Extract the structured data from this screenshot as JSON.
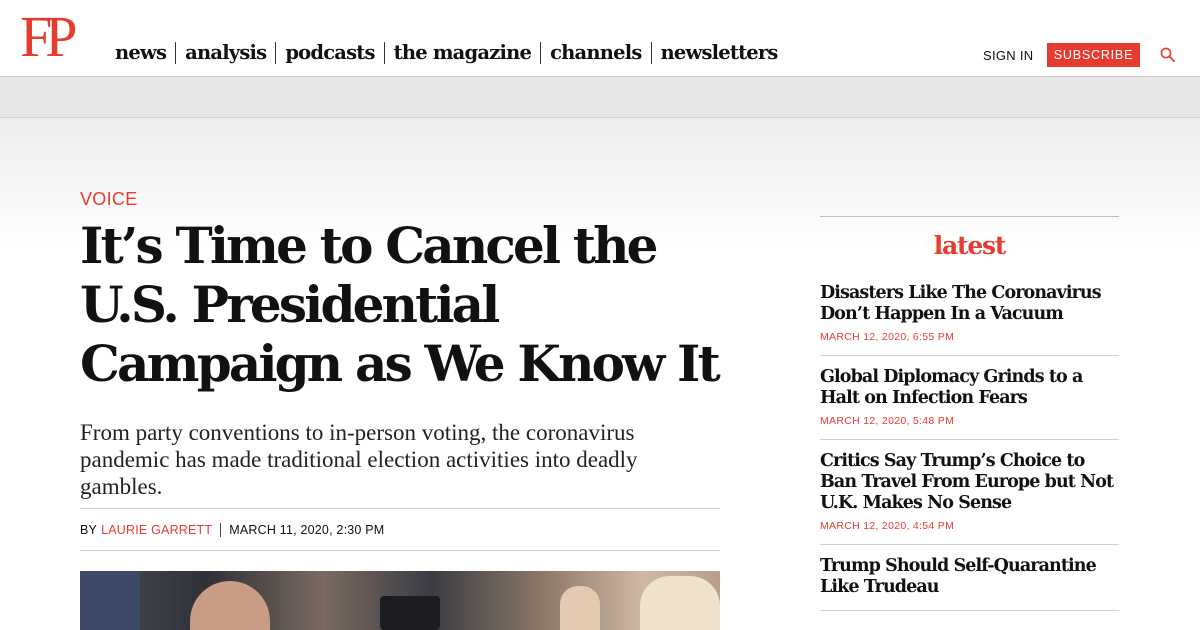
{
  "header": {
    "logo": "FP",
    "nav": [
      "news",
      "analysis",
      "podcasts",
      "the magazine",
      "channels",
      "newsletters"
    ],
    "sign_in": "SIGN IN",
    "subscribe": "SUBSCRIBE",
    "accent_color": "#e63c2f"
  },
  "article": {
    "kicker": "VOICE",
    "headline": "It’s Time to Cancel the U.S. Presidential Campaign as We Know It",
    "dek": "From party conventions to in-person voting, the coronavirus pandemic has made traditional election activities into deadly gambles.",
    "by_label": "BY",
    "author": "LAURIE GARRETT",
    "date": "MARCH 11, 2020, 2:30 PM"
  },
  "sidebar": {
    "title": "latest",
    "items": [
      {
        "title": "Disasters Like The Coronavirus Don’t Happen In a Vacuum",
        "date": "MARCH 12, 2020, 6:55 PM"
      },
      {
        "title": "Global Diplomacy Grinds to a Halt on Infection Fears",
        "date": "MARCH 12, 2020, 5:48 PM"
      },
      {
        "title": "Critics Say Trump’s Choice to Ban Travel From Europe but Not U.K. Makes No Sense",
        "date": "MARCH 12, 2020, 4:54 PM"
      },
      {
        "title": "Trump Should Self-Quarantine Like Trudeau",
        "date": ""
      }
    ]
  }
}
